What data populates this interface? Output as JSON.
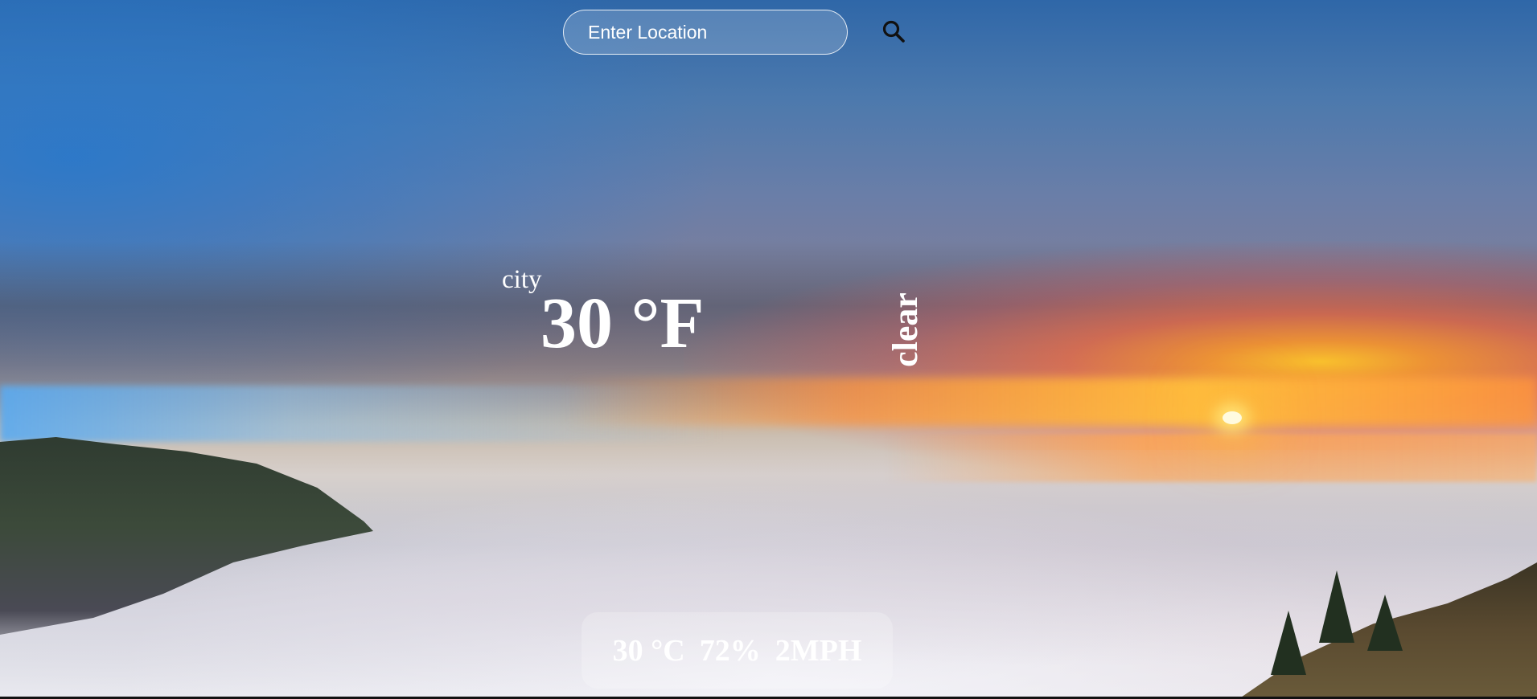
{
  "search": {
    "placeholder": "Enter Location",
    "value": "",
    "button_icon": "search-icon"
  },
  "weather": {
    "city": "city",
    "temperature": "30 ",
    "temperature_unit_symbol": "°F",
    "condition": "clear"
  },
  "details": {
    "temperature_c": "30 ",
    "temperature_c_unit": "°C",
    "humidity": "72%",
    "wind": "2MPH"
  },
  "colors": {
    "text": "#ffffff",
    "panel_bg": "rgba(255,255,255,0.22)"
  }
}
